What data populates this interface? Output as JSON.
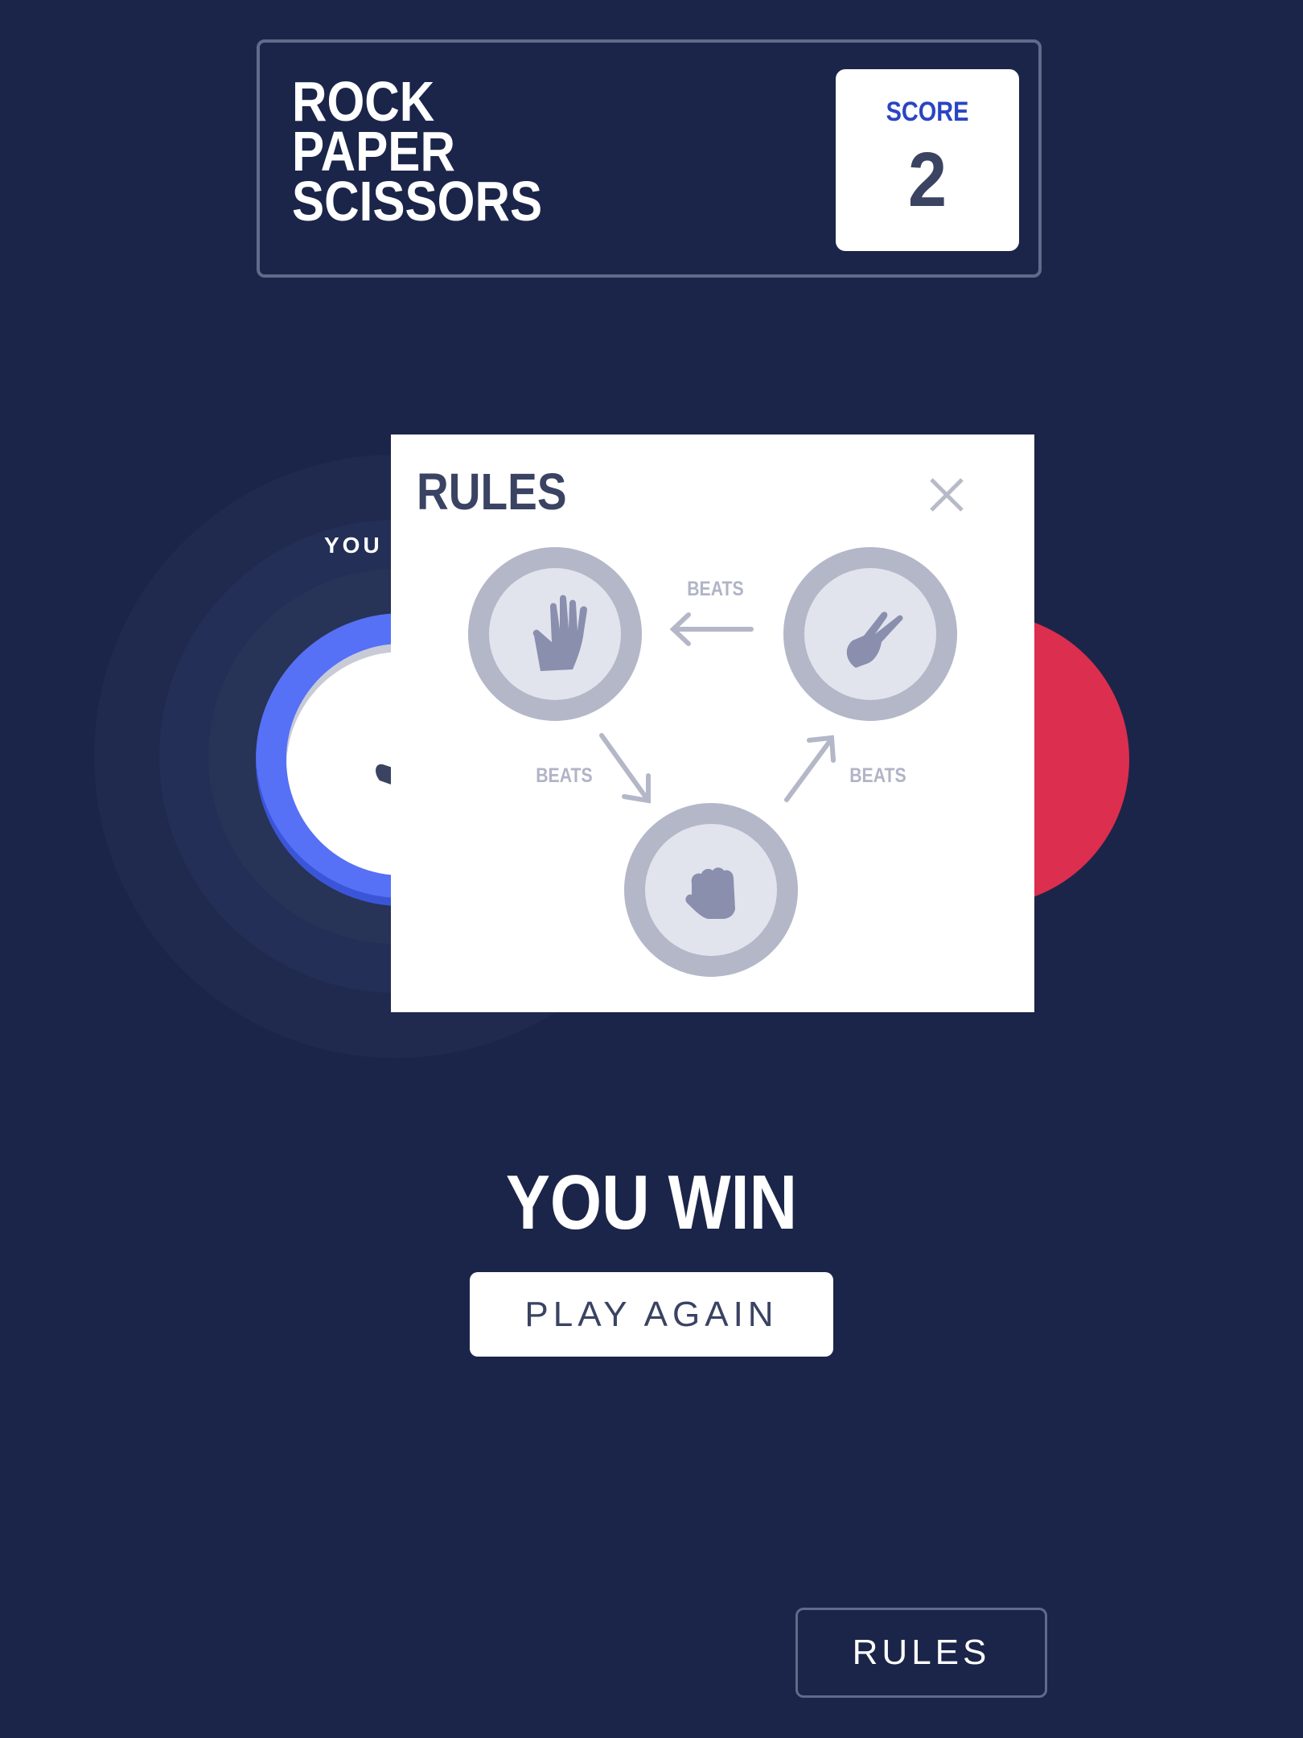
{
  "header": {
    "title_lines": [
      "ROCK",
      "PAPER",
      "SCISSORS"
    ],
    "score_label": "SCORE",
    "score_value": "2"
  },
  "game": {
    "you_picked_label": "YOU P",
    "player_pick": "scissors",
    "result_text": "YOU WIN",
    "play_again_label": "PLAY AGAIN"
  },
  "rules_button_label": "RULES",
  "rules_modal": {
    "title": "RULES",
    "close_icon": "close-icon",
    "beats_label": "BEATS",
    "chips": [
      "paper",
      "scissors",
      "rock"
    ]
  },
  "colors": {
    "background": "#1b2549",
    "paper_ring": "#5671f5",
    "rock_ring": "#dc2e4e",
    "score_label": "#2a45c2",
    "dark_text": "#3b4363",
    "modal_gray": "#b4b7c8"
  }
}
